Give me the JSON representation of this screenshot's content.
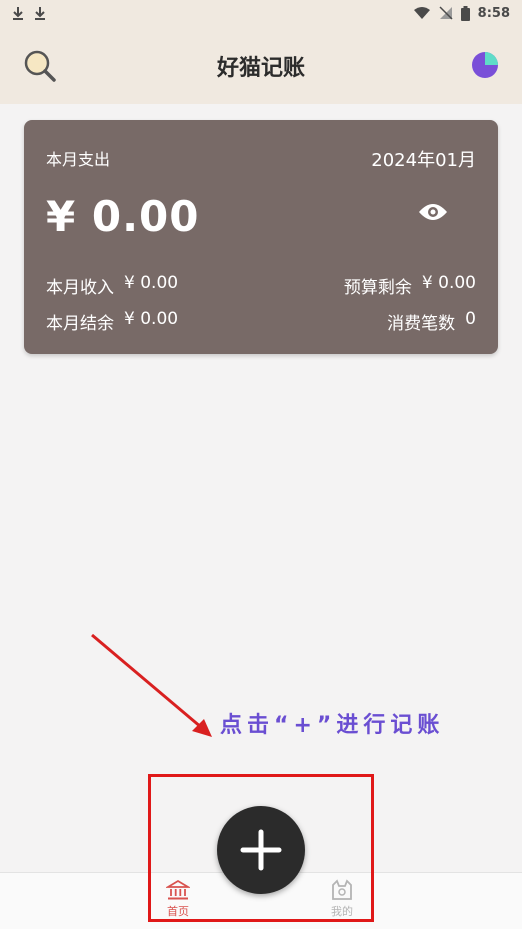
{
  "status_bar": {
    "time": "8:58"
  },
  "header": {
    "title": "好猫记账"
  },
  "summary": {
    "label": "本月支出",
    "month": "2024年01月",
    "amount": "¥ 0.00",
    "income_label": "本月收入",
    "income_value": "¥ 0.00",
    "budget_label": "预算剩余",
    "budget_value": "¥ 0.00",
    "balance_label": "本月结余",
    "balance_value": "¥ 0.00",
    "count_label": "消费笔数",
    "count_value": "0"
  },
  "annotation": {
    "hint": "点击“+”进行记账"
  },
  "fab": {
    "label": "+"
  },
  "bottom_nav": {
    "home": "首页",
    "mine": "我的"
  },
  "colors": {
    "header_bg": "#f0e9e0",
    "card_bg": "#786a67",
    "hint": "#6a4ed2",
    "annotation_red": "#e01818",
    "active_nav": "#d9534f"
  },
  "icons": {
    "search": "search-icon",
    "stats": "pie-chart-icon",
    "eye": "eye-icon",
    "home": "bank-icon",
    "mine": "cat-profile-icon"
  }
}
